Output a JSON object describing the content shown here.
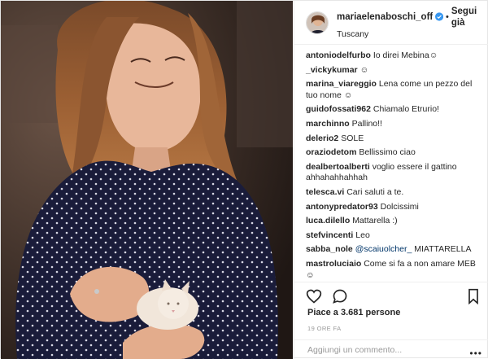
{
  "post": {
    "username": "mariaelenaboschi_off...",
    "verified_badge": "verified-icon",
    "follow_label": "Segui già",
    "separator": "•",
    "location": "Tuscany"
  },
  "comments": [
    {
      "user": "antoniodelfurbo",
      "text": "Io direi Mebina☺"
    },
    {
      "user": "_vickykumar",
      "text": "☺"
    },
    {
      "user": "marina_viareggio",
      "text": "Lena come un pezzo del tuo nome ☺"
    },
    {
      "user": "guidofossati962",
      "text": "Chiamalo Etrurio!"
    },
    {
      "user": "marchinno",
      "text": "Pallino!!"
    },
    {
      "user": "delerio2",
      "text": "SOLE"
    },
    {
      "user": "oraziodetom",
      "text": "Bellissimo ciao"
    },
    {
      "user": "dealbertoalberti",
      "text": "voglio essere il gattino ahhahahhahhah"
    },
    {
      "user": "telesca.vi",
      "text": "Cari saluti a te."
    },
    {
      "user": "antonypredator93",
      "text": "Dolcissimi"
    },
    {
      "user": "luca.dilello",
      "text": "Mattarella :)"
    },
    {
      "user": "stefvincenti",
      "text": "Leo"
    },
    {
      "user": "sabba_nole",
      "mention": "@scaiuolcher_",
      "text": "MIATTARELLA"
    },
    {
      "user": "mastroluciaio",
      "text": "Come si fa a non amare MEB ☺"
    }
  ],
  "actions": {
    "like_icon": "heart-icon",
    "comment_icon": "comment-icon",
    "save_icon": "bookmark-icon"
  },
  "likes_label": "Piace a 3.681 persone",
  "timestamp": "19 ORE FA",
  "add_comment_placeholder": "Aggiungi un commento...",
  "more_label": "•••",
  "colors": {
    "verified": "#3897f0",
    "mention": "#003569",
    "muted": "#999999",
    "text": "#262626"
  }
}
